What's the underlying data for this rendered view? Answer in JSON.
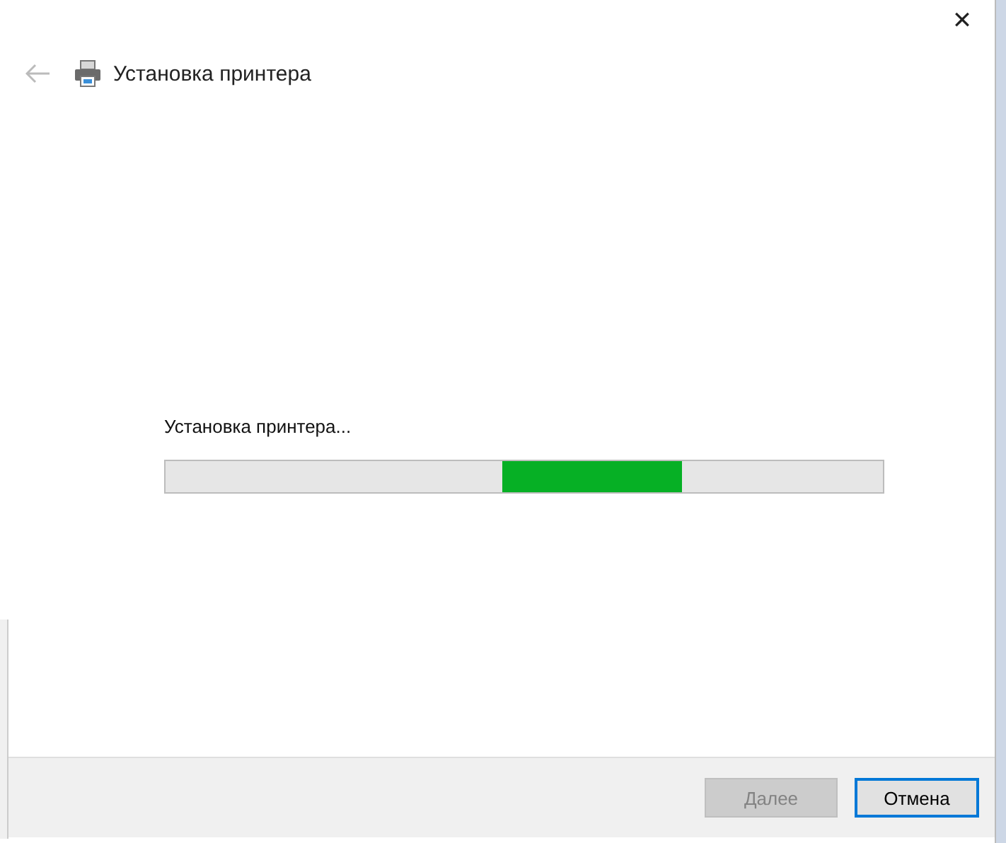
{
  "window": {
    "close": "✕"
  },
  "header": {
    "title": "Установка принтера",
    "back_enabled": false
  },
  "status": {
    "text": "Установка принтера..."
  },
  "progress": {
    "kind": "indeterminate"
  },
  "buttons": [
    {
      "label": "Далее",
      "disabled": true,
      "focused": false
    },
    {
      "label": "Отмена",
      "disabled": false,
      "focused": true
    }
  ]
}
